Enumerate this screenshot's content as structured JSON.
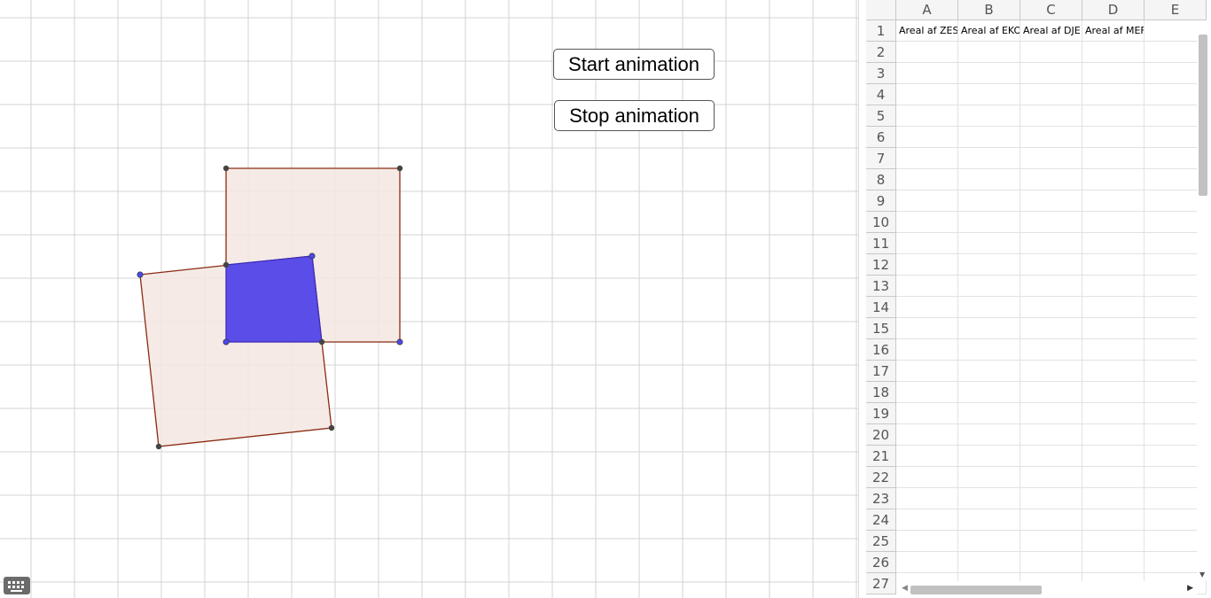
{
  "buttons": {
    "start_label": "Start animation",
    "stop_label": "Stop animation"
  },
  "icons": {
    "keyboard": "keyboard-icon",
    "scroll_left": "arrow-left-icon",
    "scroll_right": "arrow-right-icon",
    "scroll_down": "arrow-down-icon"
  },
  "colors": {
    "square_fill": "#f3e6e2",
    "square_stroke": "#8b2b10",
    "overlap_fill": "#5b4de8",
    "point_dark": "#444444",
    "point_blue": "#4a4ae8",
    "grid": "#d3d3d3"
  },
  "spreadsheet": {
    "columns": [
      "A",
      "B",
      "C",
      "D",
      "E"
    ],
    "rows": [
      "1",
      "2",
      "3",
      "4",
      "5",
      "6",
      "7",
      "8",
      "9",
      "10",
      "11",
      "12",
      "13",
      "14",
      "15",
      "16",
      "17",
      "18",
      "19",
      "20",
      "21",
      "22",
      "23",
      "24",
      "25",
      "26",
      "27"
    ],
    "row1": [
      "Areal af ZES",
      "Areal af EKO",
      "Areal af DJE",
      "Areal af MEF",
      ""
    ]
  }
}
